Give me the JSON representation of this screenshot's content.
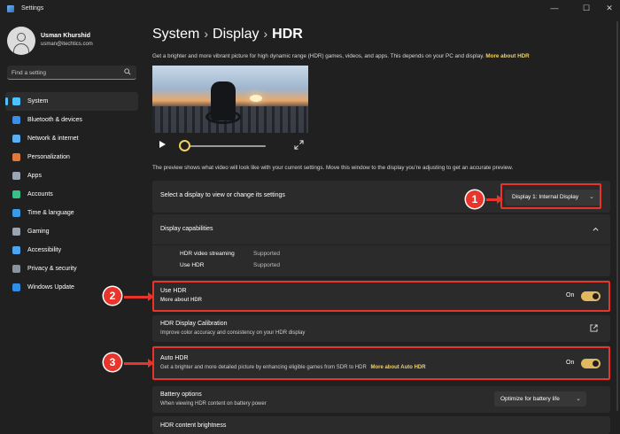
{
  "window": {
    "title": "Settings",
    "controls": {
      "minimize": "—",
      "maximize": "☐",
      "close": "✕"
    }
  },
  "profile": {
    "name": "Usman Khurshid",
    "email": "usman@itechtics.com"
  },
  "search": {
    "placeholder": "Find a setting"
  },
  "sidebar": {
    "items": [
      {
        "label": "System",
        "icon": "monitor-icon",
        "color": "#4cc2ff",
        "active": true
      },
      {
        "label": "Bluetooth & devices",
        "icon": "bluetooth-icon",
        "color": "#3a8ee6"
      },
      {
        "label": "Network & internet",
        "icon": "wifi-icon",
        "color": "#5ab0f0"
      },
      {
        "label": "Personalization",
        "icon": "brush-icon",
        "color": "#e07a38"
      },
      {
        "label": "Apps",
        "icon": "apps-icon",
        "color": "#9aa4b2"
      },
      {
        "label": "Accounts",
        "icon": "person-icon",
        "color": "#38c08a"
      },
      {
        "label": "Time & language",
        "icon": "globe-clock-icon",
        "color": "#3a9ae6"
      },
      {
        "label": "Gaming",
        "icon": "controller-icon",
        "color": "#9aa4b2"
      },
      {
        "label": "Accessibility",
        "icon": "accessibility-icon",
        "color": "#4aa6f0"
      },
      {
        "label": "Privacy & security",
        "icon": "shield-icon",
        "color": "#8a94a0"
      },
      {
        "label": "Windows Update",
        "icon": "update-icon",
        "color": "#2f8fe6"
      }
    ]
  },
  "breadcrumb": {
    "level1": "System",
    "level2": "Display",
    "current": "HDR",
    "separator": "›"
  },
  "description": {
    "text": "Get a brighter and more vibrant picture for high dynamic range (HDR) games, videos, and apps. This depends on your PC and display.",
    "link": "More about HDR"
  },
  "preview_note": "The preview shows what video will look like with your current settings. Move this window to the display you're adjusting to get an accurate preview.",
  "display_select": {
    "label": "Select a display to view or change its settings",
    "value": "Display 1: Internal Display"
  },
  "capabilities": {
    "title": "Display capabilities",
    "rows": [
      {
        "name": "HDR video streaming",
        "value": "Supported"
      },
      {
        "name": "Use HDR",
        "value": "Supported"
      }
    ]
  },
  "use_hdr": {
    "title": "Use HDR",
    "link": "More about HDR",
    "state": "On"
  },
  "calibration": {
    "title": "HDR Display Calibration",
    "subtitle": "Improve color accuracy and consistency on your HDR display"
  },
  "auto_hdr": {
    "title": "Auto HDR",
    "subtitle": "Get a brighter and more detailed picture by enhancing eligible games from SDR to HDR",
    "link": "More about Auto HDR",
    "state": "On"
  },
  "battery": {
    "title": "Battery options",
    "subtitle": "When viewing HDR content on battery power",
    "value": "Optimize for battery life"
  },
  "brightness": {
    "title": "HDR content brightness"
  },
  "annotations": {
    "badge1": "1",
    "badge2": "2",
    "badge3": "3"
  },
  "colors": {
    "accent": "#4cc2ff",
    "toggle_on": "#e0b860",
    "link": "#f0d060",
    "annotation": "#e8342a"
  }
}
